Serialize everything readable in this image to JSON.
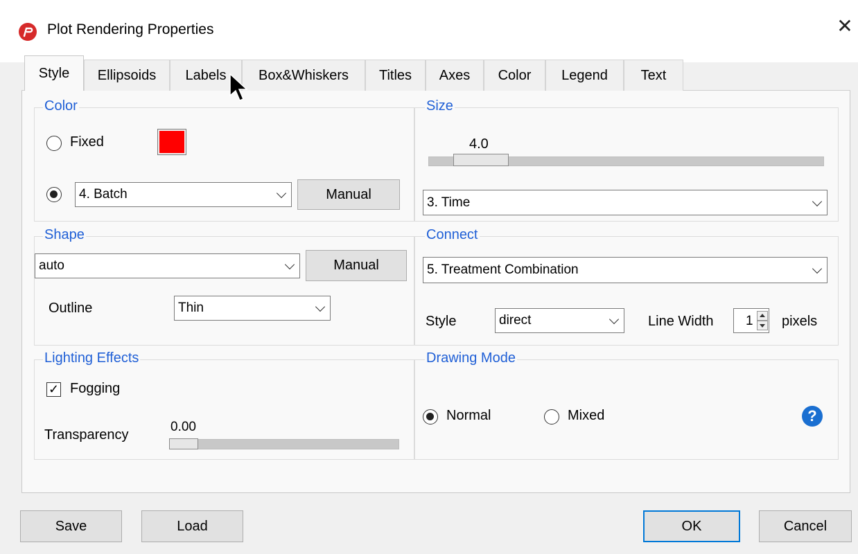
{
  "window": {
    "title": "Plot Rendering Properties",
    "close_glyph": "✕"
  },
  "tabs": [
    {
      "label": "Style",
      "active": true
    },
    {
      "label": "Ellipsoids",
      "active": false
    },
    {
      "label": "Labels",
      "active": false
    },
    {
      "label": "Box&Whiskers",
      "active": false
    },
    {
      "label": "Titles",
      "active": false
    },
    {
      "label": "Axes",
      "active": false
    },
    {
      "label": "Color",
      "active": false
    },
    {
      "label": "Legend",
      "active": false
    },
    {
      "label": "Text",
      "active": false
    }
  ],
  "color_group": {
    "title": "Color",
    "fixed_label": "Fixed",
    "fixed_selected": false,
    "swatch_color": "#ff0000",
    "variable_selected": true,
    "variable_value": "4. Batch",
    "manual_label": "Manual"
  },
  "size_group": {
    "title": "Size",
    "slider_value": "4.0",
    "variable_value": "3. Time"
  },
  "shape_group": {
    "title": "Shape",
    "shape_value": "auto",
    "manual_label": "Manual",
    "outline_label": "Outline",
    "outline_value": "Thin"
  },
  "connect_group": {
    "title": "Connect",
    "connect_value": "5. Treatment Combination",
    "style_label": "Style",
    "style_value": "direct",
    "line_width_label": "Line Width",
    "line_width_value": "1",
    "pixels_label": "pixels"
  },
  "lighting_group": {
    "title": "Lighting Effects",
    "fogging_label": "Fogging",
    "fogging_checked": true,
    "check_glyph": "✓",
    "transparency_label": "Transparency",
    "transparency_value": "0.00"
  },
  "drawing_group": {
    "title": "Drawing Mode",
    "normal_label": "Normal",
    "normal_selected": true,
    "mixed_label": "Mixed",
    "mixed_selected": false,
    "help_glyph": "?"
  },
  "footer": {
    "save_label": "Save",
    "load_label": "Load",
    "ok_label": "OK",
    "cancel_label": "Cancel"
  },
  "colors": {
    "accent": "#1f5fd6",
    "default_button_border": "#0078d7",
    "help_icon": "#1a6fd1"
  }
}
